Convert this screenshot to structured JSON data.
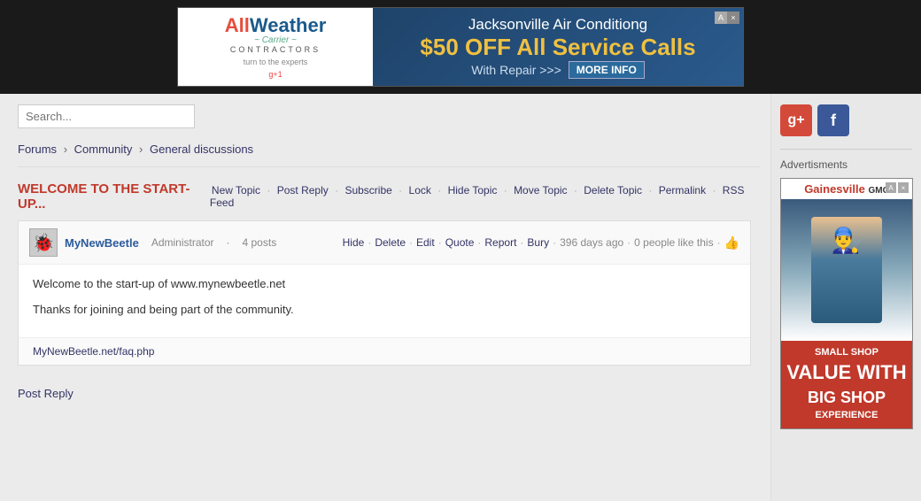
{
  "banner": {
    "logo": "AllWeather",
    "logo_sub": "CONTRACTORS",
    "logo_tagline": "turn to the experts",
    "carrier": "Carrier",
    "title": "Jacksonville Air Conditiong",
    "offer": "$50 OFF All Service Calls",
    "sub": "With Repair >>>",
    "more_btn": "MORE INFO",
    "close": "×",
    "adx": "AdX"
  },
  "search": {
    "placeholder": "Search..."
  },
  "breadcrumb": {
    "forums": "Forums",
    "community": "Community",
    "general": "General discussions"
  },
  "topic": {
    "title": "WELCOME TO THE START-UP...",
    "actions": {
      "new_topic": "New Topic",
      "post_reply": "Post Reply",
      "subscribe": "Subscribe",
      "lock": "Lock",
      "hide_topic": "Hide Topic",
      "move_topic": "Move Topic",
      "delete_topic": "Delete Topic",
      "permalink": "Permalink",
      "rss_feed": "RSS Feed"
    }
  },
  "post": {
    "author": {
      "name": "MyNewBeetle",
      "role": "Administrator",
      "posts": "4 posts"
    },
    "actions": {
      "hide": "Hide",
      "delete": "Delete",
      "edit": "Edit",
      "quote": "Quote",
      "report": "Report",
      "bury": "Bury"
    },
    "time": "396 days ago",
    "likes": "0 people like this",
    "body_line1": "Welcome to the start-up of www.mynewbeetle.net",
    "body_line2": "Thanks for joining and being part of the community.",
    "link": "MyNewBeetle.net/faq.php"
  },
  "footer": {
    "post_reply": "Post Reply"
  },
  "sidebar": {
    "google_label": "g+",
    "facebook_label": "f",
    "advertisments": "Advertisments",
    "ad": {
      "logo": "Gainesville",
      "logo_sub": "GMC",
      "text_line1": "SMALL SHOP",
      "text_line2": "VALUE WITH",
      "text_line3": "BIG SHOP",
      "text_line4": "EXPERIENCE"
    }
  }
}
